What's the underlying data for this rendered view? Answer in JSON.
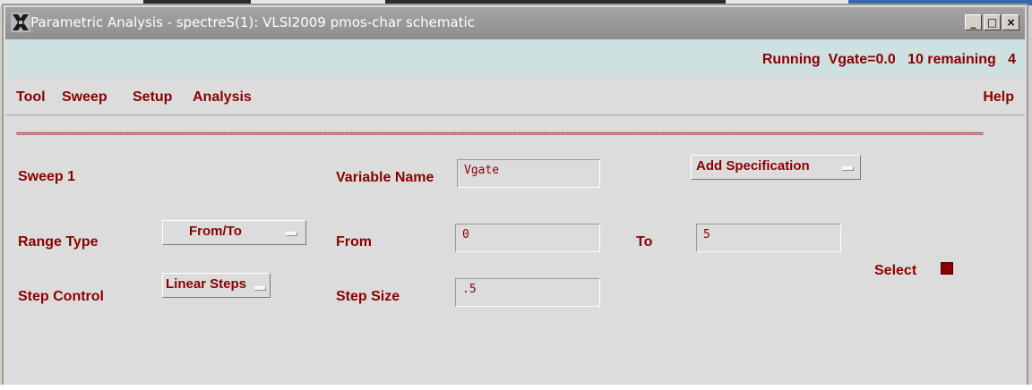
{
  "window": {
    "title": "Parametric Analysis - spectreS(1): VLSI2009 pmos-char schematic",
    "controls": {
      "minimize": "_",
      "maximize": "□",
      "close": "×"
    }
  },
  "status": {
    "text": "Running  Vgate=0.0   10 remaining   4"
  },
  "menu": {
    "tool": "Tool",
    "sweep": "Sweep",
    "setup": "Setup",
    "analysis": "Analysis",
    "help": "Help"
  },
  "separator": "================================================================================================================================================================================================================================",
  "form": {
    "sweep_label": "Sweep 1",
    "variable_name_label": "Variable Name",
    "variable_name_value": "Vgate",
    "add_spec_label": "Add Specification",
    "range_type_label": "Range Type",
    "range_type_value": "From/To",
    "from_label": "From",
    "from_value": "0",
    "to_label": "To",
    "to_value": "5",
    "select_label": "Select",
    "step_control_label": "Step Control",
    "step_control_value": "Linear Steps",
    "step_size_label": "Step Size",
    "step_size_value": ".5"
  },
  "colors": {
    "label": "#8b0000",
    "status_bg": "#cfe0e0",
    "window_bg": "#dcdcdc",
    "titlebar": "#999999"
  }
}
